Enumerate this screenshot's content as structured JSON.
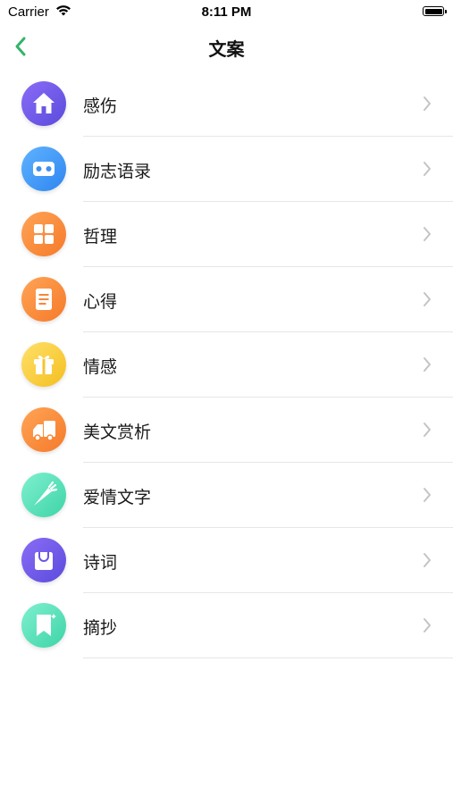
{
  "status": {
    "carrier": "Carrier",
    "time": "8:11 PM"
  },
  "nav": {
    "title": "文案"
  },
  "theme": {
    "accent": "#34b36b"
  },
  "items": [
    {
      "label": "感伤",
      "icon": "home-icon",
      "color1": "#8a6cf7",
      "color2": "#5b4bdc"
    },
    {
      "label": "励志语录",
      "icon": "vr-glasses-icon",
      "color1": "#5fb3ff",
      "color2": "#2f86f0"
    },
    {
      "label": "哲理",
      "icon": "grid-icon",
      "color1": "#ffa456",
      "color2": "#f57a2a"
    },
    {
      "label": "心得",
      "icon": "document-icon",
      "color1": "#ffa456",
      "color2": "#f57a2a"
    },
    {
      "label": "情感",
      "icon": "gift-box-icon",
      "color1": "#ffe06a",
      "color2": "#f4bf1f"
    },
    {
      "label": "美文赏析",
      "icon": "truck-icon",
      "color1": "#ffa456",
      "color2": "#f57a2a"
    },
    {
      "label": "爱情文字",
      "icon": "carrot-icon",
      "color1": "#7ff0cf",
      "color2": "#3ed4a8"
    },
    {
      "label": "诗词",
      "icon": "bag-icon",
      "color1": "#8a6cf7",
      "color2": "#5b4bdc"
    },
    {
      "label": "摘抄",
      "icon": "bookmark-icon",
      "color1": "#7ff0cf",
      "color2": "#3ed4a8"
    }
  ]
}
